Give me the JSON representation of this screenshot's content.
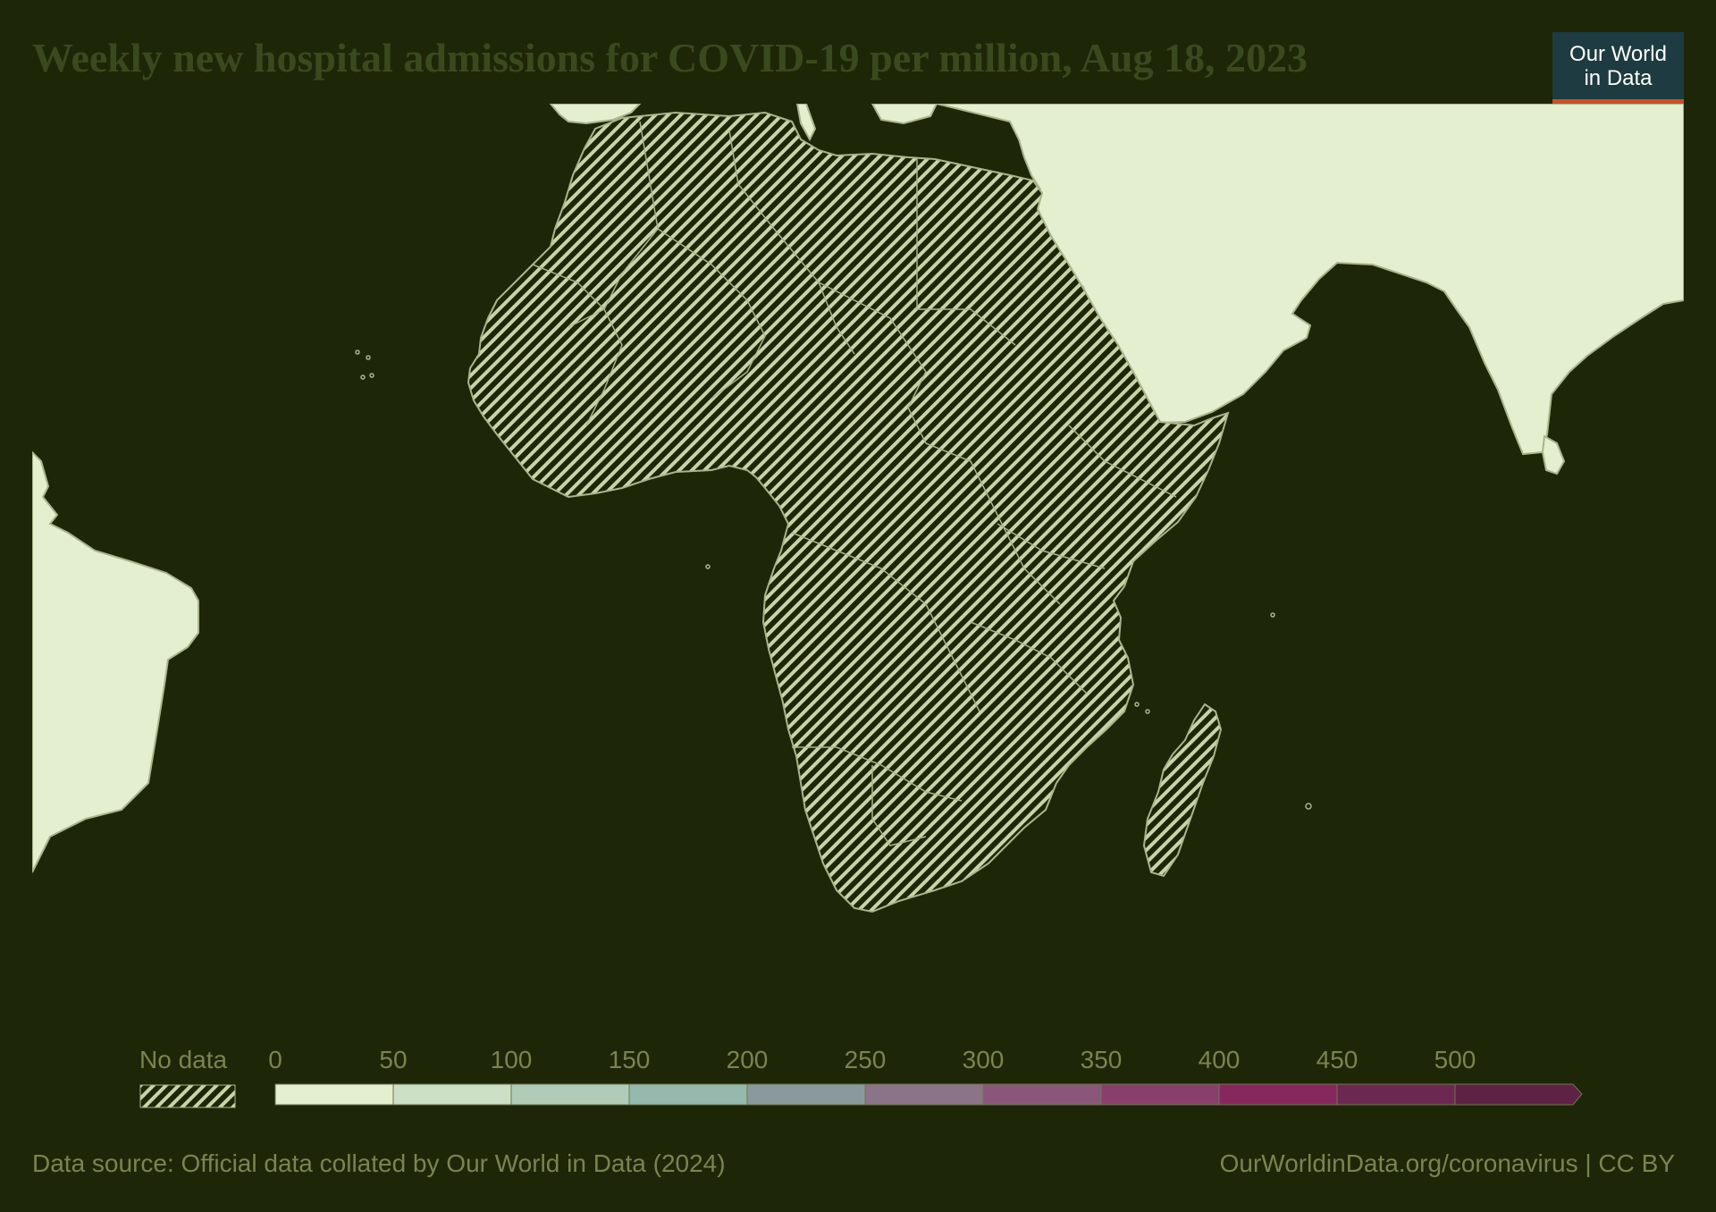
{
  "title": "Weekly new hospital admissions for COVID-19 per million, Aug 18, 2023",
  "logo": {
    "line1": "Our World",
    "line2": "in Data"
  },
  "colors": {
    "background": "#1e2608",
    "land": "#e4efcf",
    "border": "#a9b58c",
    "no_data_stripe": "#c8d4a8",
    "logo_bg": "#1d3b40",
    "logo_accent": "#c8502c"
  },
  "map": {
    "region": "Africa",
    "hatched_regions": [
      "Africa",
      "Madagascar"
    ],
    "shaded_regions_color": "#e4efcf",
    "shaded_regions": [
      "South America",
      "Europe",
      "Middle East",
      "South Asia"
    ]
  },
  "legend": {
    "no_data_label": "No data",
    "ticks": [
      "0",
      "50",
      "100",
      "150",
      "200",
      "250",
      "300",
      "350",
      "400",
      "450",
      "500"
    ],
    "bin_colors": [
      "#e4efcf",
      "#cbe0c4",
      "#b0ccb8",
      "#97b8ad",
      "#8a9a9c",
      "#8c7488",
      "#8a577a",
      "#883f6c",
      "#86285e",
      "#6b2951",
      "#5e2244"
    ]
  },
  "footer": {
    "source": "Data source: Official data collated by Our World in Data (2024)",
    "url": "OurWorldinData.org/coronavirus | CC BY"
  }
}
